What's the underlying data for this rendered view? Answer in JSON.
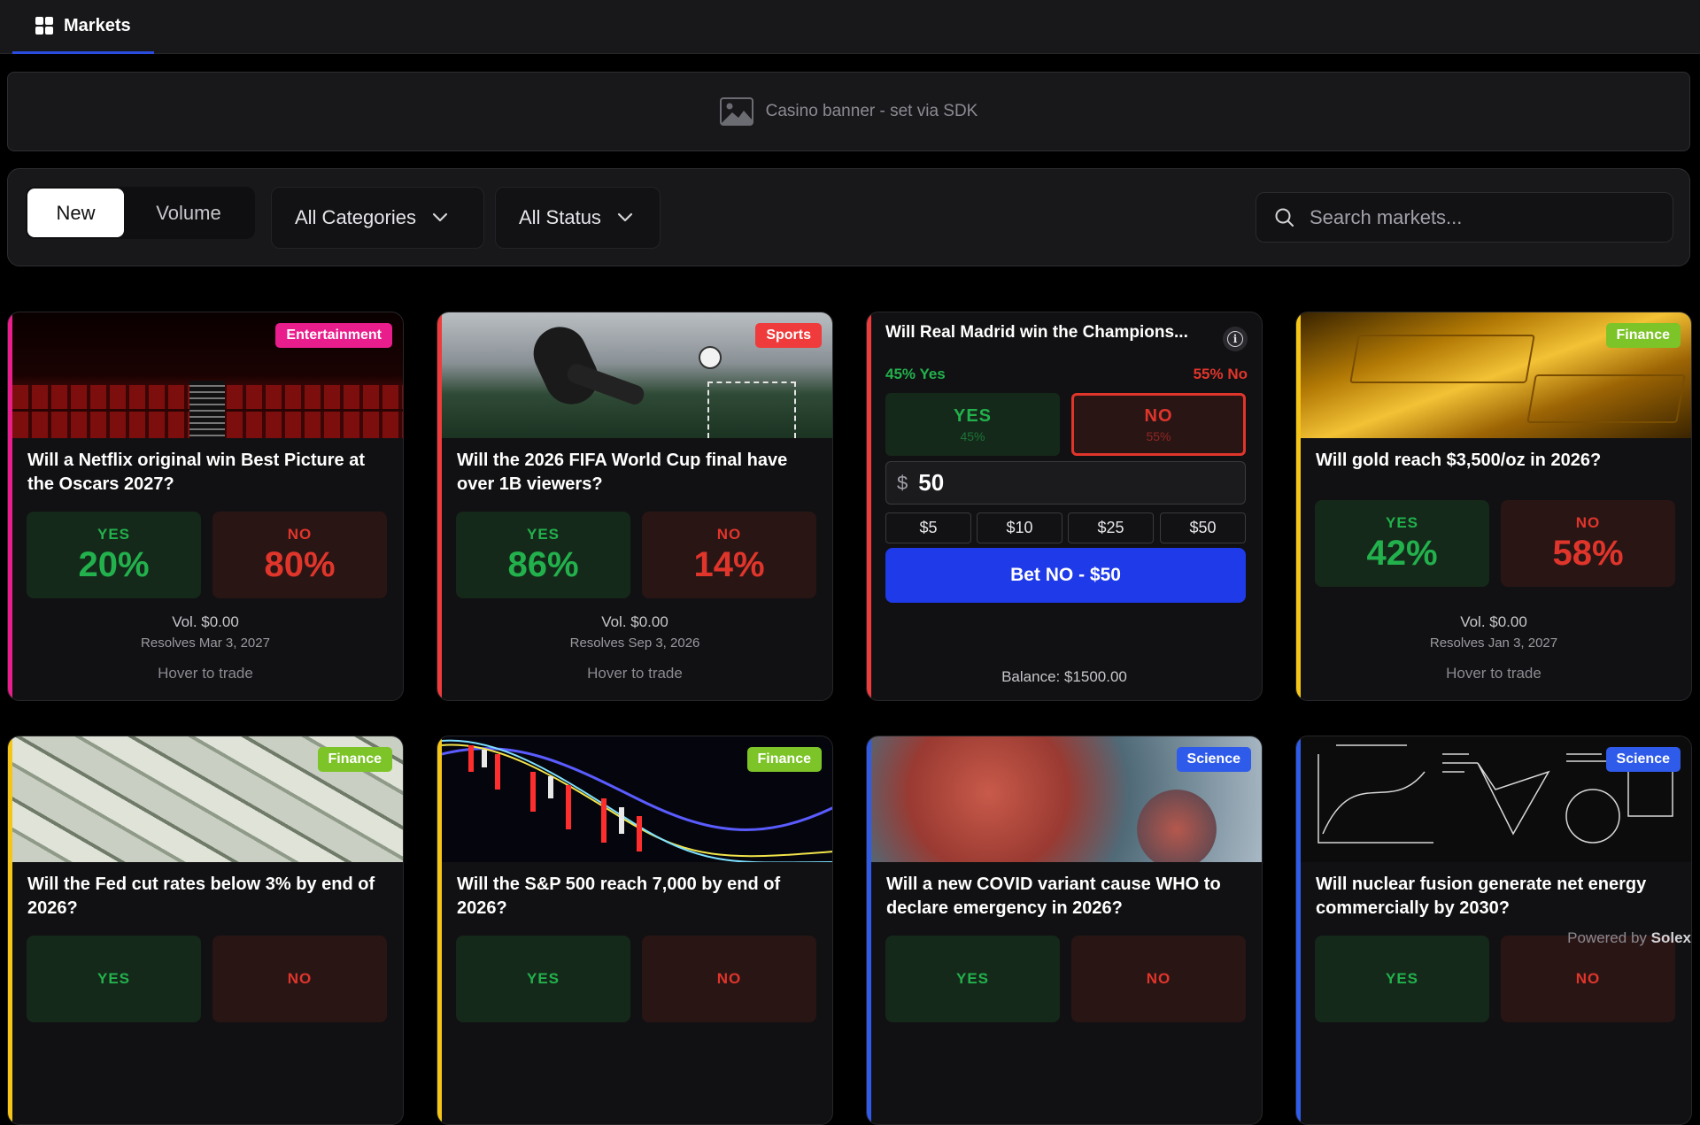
{
  "nav": {
    "tab_label": "Markets"
  },
  "banner": {
    "text": "Casino banner - set via SDK"
  },
  "filters": {
    "sort_options": [
      "New",
      "Volume"
    ],
    "active_sort": "New",
    "category_label": "All Categories",
    "status_label": "All Status",
    "search_placeholder": "Search markets..."
  },
  "cards": [
    {
      "badge": "Entertainment",
      "badge_color": "#e91e8c",
      "accent_color": "#e91e8c",
      "question": "Will a Netflix original win Best Picture at the Oscars 2027?",
      "yes_label": "YES",
      "yes_pct": "20%",
      "no_label": "NO",
      "no_pct": "80%",
      "volume": "Vol. $0.00",
      "resolves": "Resolves Mar 3, 2027",
      "hover": "Hover to trade"
    },
    {
      "badge": "Sports",
      "badge_color": "#ef3b3b",
      "accent_color": "#ef3b3b",
      "question": "Will the 2026 FIFA World Cup final have over 1B viewers?",
      "yes_label": "YES",
      "yes_pct": "86%",
      "no_label": "NO",
      "no_pct": "14%",
      "volume": "Vol. $0.00",
      "resolves": "Resolves Sep 3, 2026",
      "hover": "Hover to trade"
    },
    {
      "accent_color": "#ef3b3b",
      "question": "Will Real Madrid win the Champions...",
      "yes_summary": "45% Yes",
      "no_summary": "55% No",
      "yes_label": "YES",
      "yes_sub": "45%",
      "no_label": "NO",
      "no_sub": "55%",
      "currency": "$",
      "amount": "50",
      "quick_amounts": [
        "$5",
        "$10",
        "$25",
        "$50"
      ],
      "bet_label": "Bet NO - $50",
      "balance": "Balance: $1500.00"
    },
    {
      "badge": "Finance",
      "badge_color": "#7cc427",
      "accent_color": "#f5c518",
      "question": "Will gold reach $3,500/oz in 2026?",
      "yes_label": "YES",
      "yes_pct": "42%",
      "no_label": "NO",
      "no_pct": "58%",
      "volume": "Vol. $0.00",
      "resolves": "Resolves Jan 3, 2027",
      "hover": "Hover to trade"
    },
    {
      "badge": "Finance",
      "badge_color": "#7cc427",
      "accent_color": "#f5c518",
      "question": "Will the Fed cut rates below 3% by end of 2026?",
      "yes_label": "YES",
      "no_label": "NO"
    },
    {
      "badge": "Finance",
      "badge_color": "#7cc427",
      "accent_color": "#f5c518",
      "question": "Will the S&P 500 reach 7,000 by end of 2026?",
      "yes_label": "YES",
      "no_label": "NO"
    },
    {
      "badge": "Science",
      "badge_color": "#2f5bea",
      "accent_color": "#2f5bea",
      "question": "Will a new COVID variant cause WHO to declare emergency in 2026?",
      "yes_label": "YES",
      "no_label": "NO"
    },
    {
      "badge": "Science",
      "badge_color": "#2f5bea",
      "accent_color": "#2f5bea",
      "question": "Will nuclear fusion generate net energy commercially by 2030?",
      "yes_label": "YES",
      "no_label": "NO"
    }
  ],
  "footer": {
    "powered_prefix": "Powered by",
    "powered_brand": "Solex"
  }
}
